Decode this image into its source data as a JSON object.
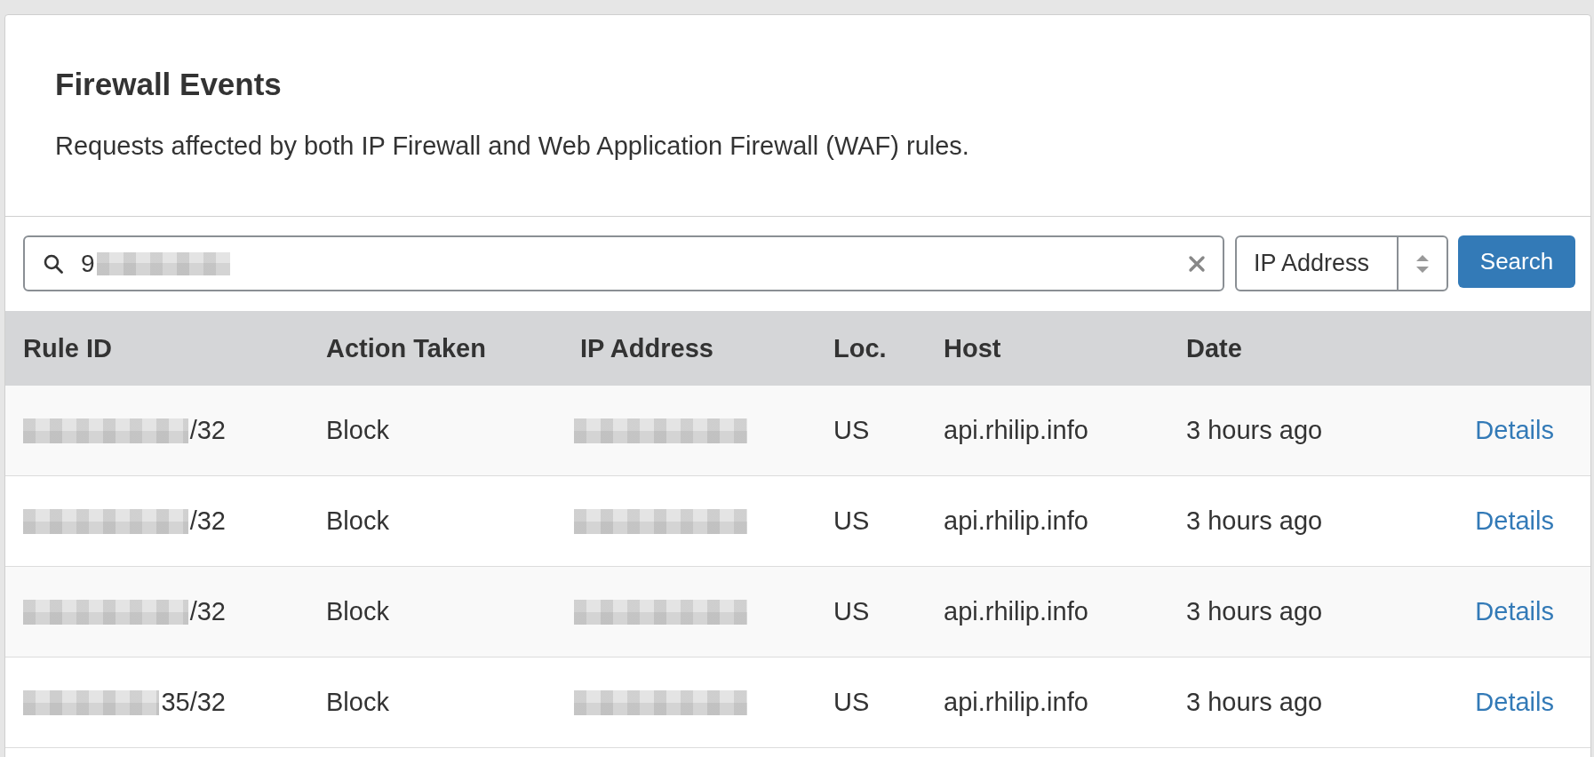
{
  "card": {
    "title": "Firewall Events",
    "description": "Requests affected by both IP Firewall and Web Application Firewall (WAF) rules."
  },
  "search": {
    "value": "9",
    "filter": "IP Address",
    "button": "Search"
  },
  "table": {
    "columns": [
      "Rule ID",
      "Action Taken",
      "IP Address",
      "Loc.",
      "Host",
      "Date"
    ],
    "rows": [
      {
        "rule_id": "/32",
        "action": "Block",
        "location": "US",
        "host": "api.rhilip.info",
        "date": "3 hours ago",
        "link": "Details"
      },
      {
        "rule_id": "/32",
        "action": "Block",
        "location": "US",
        "host": "api.rhilip.info",
        "date": "3 hours ago",
        "link": "Details"
      },
      {
        "rule_id": "/32",
        "action": "Block",
        "location": "US",
        "host": "api.rhilip.info",
        "date": "3 hours ago",
        "link": "Details"
      },
      {
        "rule_id": "35/32",
        "action": "Block",
        "location": "US",
        "host": "api.rhilip.info",
        "date": "3 hours ago",
        "link": "Details"
      }
    ]
  }
}
